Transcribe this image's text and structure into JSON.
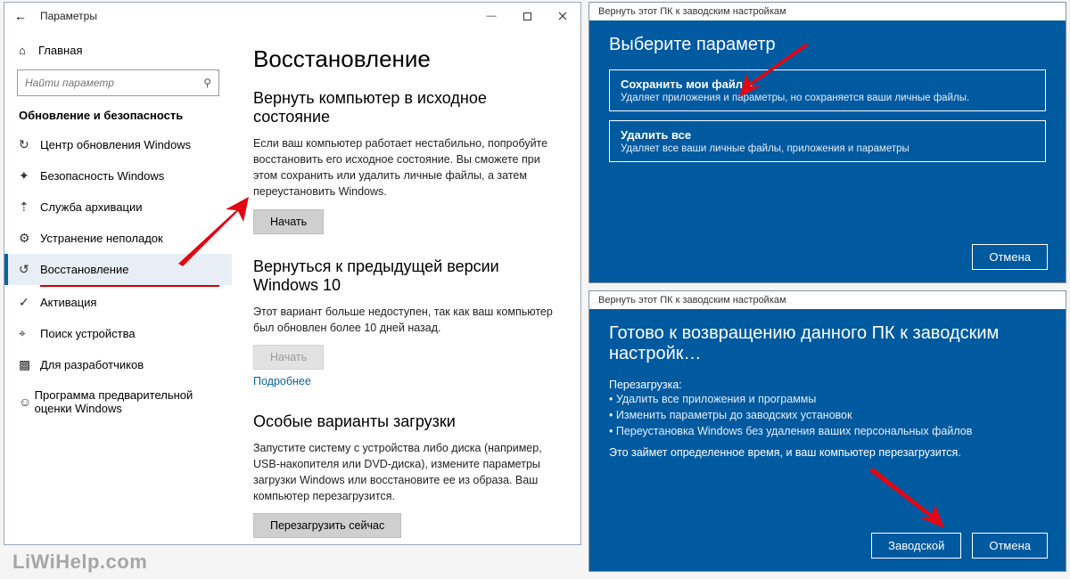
{
  "watermark": "LiWiHelp.com",
  "settings": {
    "app_title": "Параметры",
    "home_label": "Главная",
    "search_placeholder": "Найти параметр",
    "section_label": "Обновление и безопасность",
    "nav": [
      {
        "label": "Центр обновления Windows"
      },
      {
        "label": "Безопасность Windows"
      },
      {
        "label": "Служба архивации"
      },
      {
        "label": "Устранение неполадок"
      },
      {
        "label": "Восстановление",
        "active": true
      },
      {
        "label": "Активация"
      },
      {
        "label": "Поиск устройства"
      },
      {
        "label": "Для разработчиков"
      },
      {
        "label": "Программа предварительной оценки Windows"
      }
    ],
    "content": {
      "title": "Восстановление",
      "reset": {
        "heading": "Вернуть компьютер в исходное состояние",
        "desc": "Если ваш компьютер работает нестабильно, попробуйте восстановить его исходное состояние. Вы сможете при этом сохранить или удалить личные файлы, а затем переустановить Windows.",
        "button": "Начать"
      },
      "goback": {
        "heading": "Вернуться к предыдущей версии Windows 10",
        "desc": "Этот вариант больше недоступен, так как ваш компьютер был обновлен более 10 дней назад.",
        "button": "Начать",
        "link": "Подробнее"
      },
      "advanced": {
        "heading": "Особые варианты загрузки",
        "desc": "Запустите систему с устройства либо диска (например, USB-накопителя или DVD-диска), измените параметры загрузки Windows или восстановите ее из образа. Ваш компьютер перезагрузится.",
        "button": "Перезагрузить сейчас"
      }
    }
  },
  "dialog1": {
    "window_title": "Вернуть этот ПК к заводским настройкам",
    "heading": "Выберите параметр",
    "options": [
      {
        "title": "Сохранить мои файлы",
        "desc": "Удаляет приложения и параметры, но сохраняется ваши личные файлы."
      },
      {
        "title": "Удалить все",
        "desc": "Удаляет все ваши личные файлы, приложения и параметры"
      }
    ],
    "cancel": "Отмена"
  },
  "dialog2": {
    "window_title": "Вернуть этот ПК к заводским настройкам",
    "heading": "Готово к возвращению данного ПК к заводским настройк…",
    "reboot_label": "Перезагрузка:",
    "bullets": [
      "• Удалить все приложения и программы",
      "• Изменить параметры до заводских установок",
      "• Переустановка Windows без удаления ваших персональных файлов"
    ],
    "note": "Это займет определенное время, и ваш компьютер перезагрузится.",
    "primary": "Заводской",
    "cancel": "Отмена"
  }
}
